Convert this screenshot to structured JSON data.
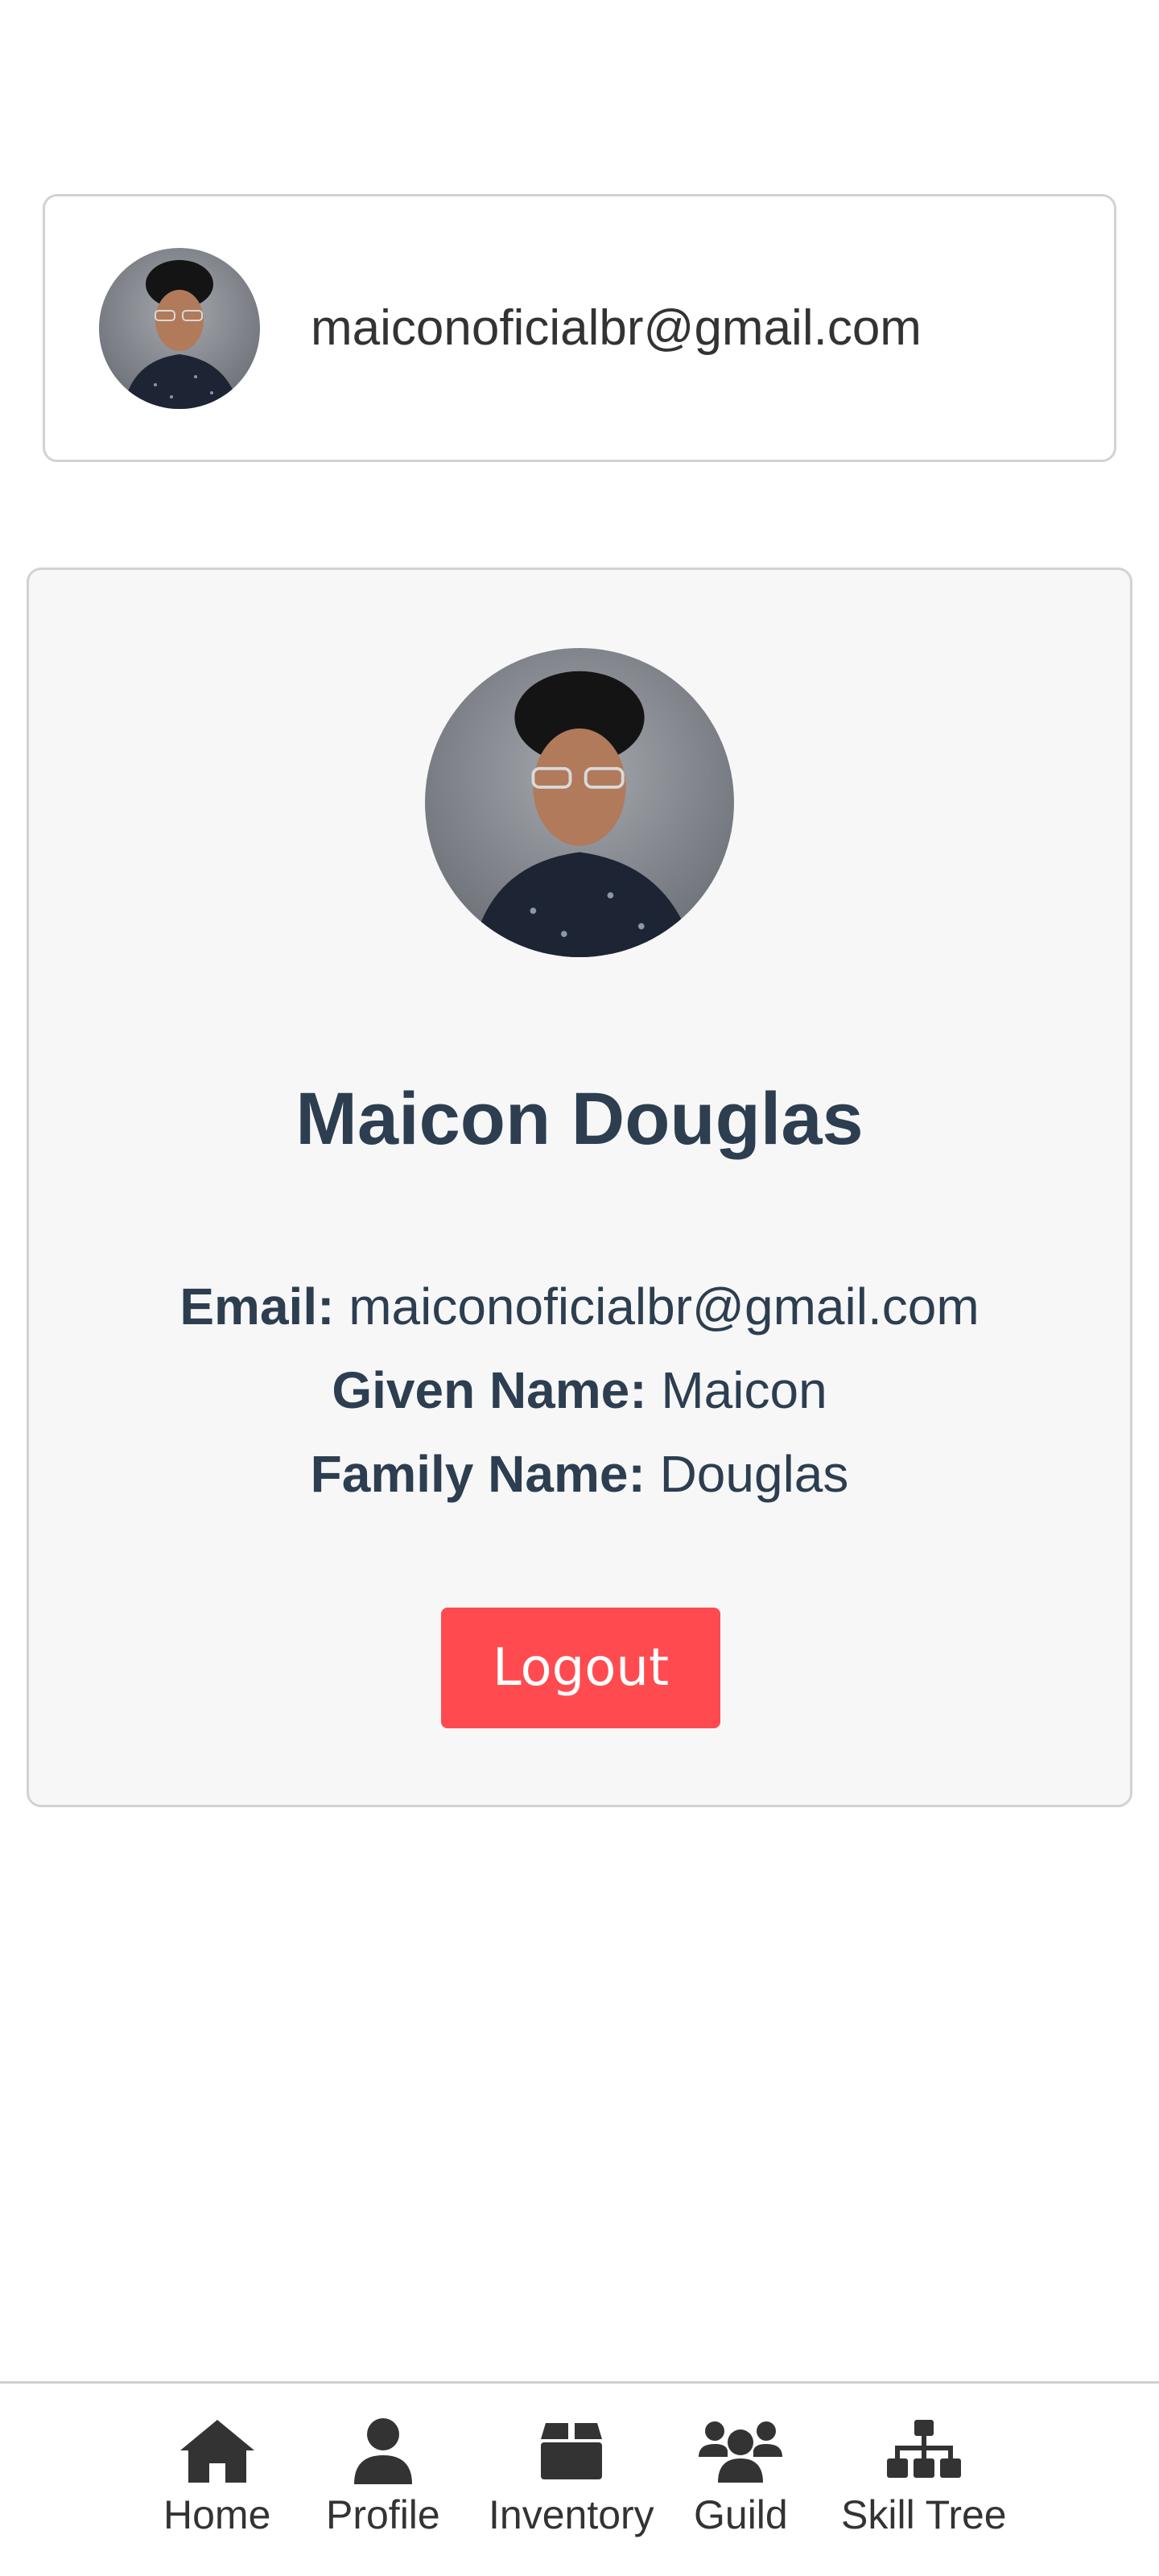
{
  "user_card": {
    "email": "maiconoficialbr@gmail.com"
  },
  "profile": {
    "name": "Maicon Douglas",
    "email_label": "Email:",
    "email_value": "maiconoficialbr@gmail.com",
    "given_name_label": "Given Name:",
    "given_name_value": "Maicon",
    "family_name_label": "Family Name:",
    "family_name_value": "Douglas",
    "logout_label": "Logout"
  },
  "nav": {
    "items": [
      {
        "label": "Home",
        "icon": "home-icon"
      },
      {
        "label": "Profile",
        "icon": "user-icon"
      },
      {
        "label": "Inventory",
        "icon": "box-icon"
      },
      {
        "label": "Guild",
        "icon": "users-icon"
      },
      {
        "label": "Skill Tree",
        "icon": "sitemap-icon"
      }
    ]
  },
  "colors": {
    "logout_bg": "#ff4b4f",
    "heading_text": "#2c3e50",
    "card_bg": "#f7f7f8",
    "nav_icon": "#333333"
  }
}
